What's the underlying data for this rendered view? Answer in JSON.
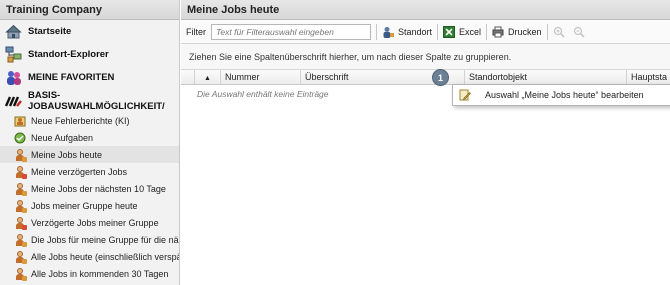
{
  "sidebar": {
    "title": "Training Company",
    "sections": [
      {
        "label": "Startseite",
        "icon": "home-icon"
      },
      {
        "label": "Standort-Explorer",
        "icon": "sitemap-icon"
      },
      {
        "label": "MEINE FAVORITEN",
        "icon": "favorites-icon"
      },
      {
        "label": "BASIS-JOBAUSWAHLMÖGLICHKEIT/",
        "icon": "selection-icon"
      }
    ],
    "items": [
      {
        "label": "Neue Fehlerberichte (KI)",
        "icon": "report-icon",
        "badge": "#c8a13a"
      },
      {
        "label": "Neue Aufgaben",
        "icon": "task-icon",
        "badge": "#5a9a3a"
      },
      {
        "label": "Meine Jobs heute",
        "icon": "person-icon",
        "badge": "#d89a3a"
      },
      {
        "label": "Meine verzögerten Jobs",
        "icon": "person-icon",
        "badge": "#d84a3a"
      },
      {
        "label": "Meine Jobs der nächsten 10 Tage",
        "icon": "person-icon",
        "badge": "#d89a3a"
      },
      {
        "label": "Jobs meiner Gruppe heute",
        "icon": "group-icon",
        "badge": "#d89a3a"
      },
      {
        "label": "Verzögerte Jobs meiner Gruppe",
        "icon": "group-icon",
        "badge": "#d84a3a"
      },
      {
        "label": "Die Jobs für meine Gruppe für die nä",
        "icon": "group-icon",
        "badge": "#d89a3a"
      },
      {
        "label": "Alle Jobs heute (einschließlich verspä",
        "icon": "person-icon",
        "badge": "#d89a3a"
      },
      {
        "label": "Alle Jobs in kommenden 30 Tagen",
        "icon": "person-icon",
        "badge": "#d89a3a"
      }
    ],
    "active_index": 2
  },
  "main": {
    "title": "Meine Jobs heute",
    "toolbar": {
      "filter_label": "Filter",
      "filter_placeholder": "Text für Filterauswahl eingeben",
      "standort_label": "Standort",
      "excel_label": "Excel",
      "print_label": "Drucken"
    },
    "group_hint": "Ziehen Sie eine Spaltenüberschrift hierher, um nach dieser Spalte zu gruppieren.",
    "columns": [
      "",
      "Nummer",
      "Überschrift",
      "Standortobjekt",
      "Hauptsta"
    ],
    "empty_text": "Die Auswahl enthält keine Einträge"
  },
  "callout": {
    "number": "1",
    "menu_item": "Auswahl „Meine Jobs heute“ bearbeiten"
  },
  "colors": {
    "header_bg": "#dcdcdc",
    "sidebar_bg": "#f2f2f2",
    "active_item_bg": "#e3e3e3",
    "callout_badge": "#6b8095"
  }
}
